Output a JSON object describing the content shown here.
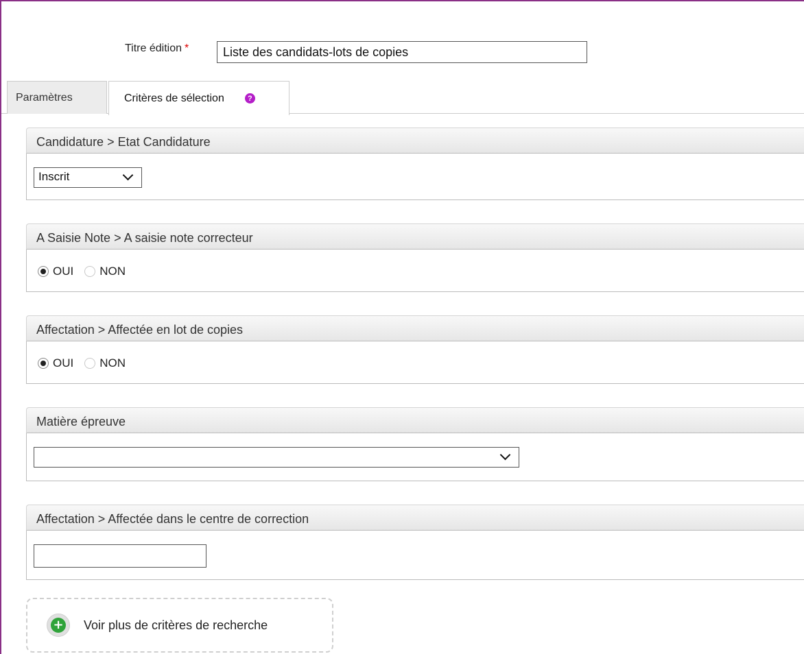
{
  "form": {
    "title_label": "Titre édition",
    "required_mark": "*",
    "title_value": "Liste des candidats-lots de copies"
  },
  "tabs": [
    {
      "label": "Paramètres",
      "active": false
    },
    {
      "label": "Critères de sélection",
      "active": true
    }
  ],
  "criteria": {
    "etat": {
      "header": "Candidature > Etat Candidature",
      "selected": "Inscrit"
    },
    "saisie": {
      "header": "A Saisie Note > A saisie note correcteur",
      "options": [
        "OUI",
        "NON"
      ],
      "selected": "OUI"
    },
    "affectation_lot": {
      "header": "Affectation > Affectée en lot de copies",
      "options": [
        "OUI",
        "NON"
      ],
      "selected": "OUI"
    },
    "matiere": {
      "header": "Matière épreuve",
      "selected": ""
    },
    "centre": {
      "header": "Affectation > Affectée dans le centre de correction",
      "value": ""
    }
  },
  "more_criteria_label": "Voir plus de critères de recherche",
  "icons": {
    "help": "help-icon",
    "add": "plus-circle-icon"
  },
  "colors": {
    "frame": "#8a2f86",
    "help": "#b41ec8",
    "add": "#2fa33a",
    "required": "#dd0000"
  }
}
